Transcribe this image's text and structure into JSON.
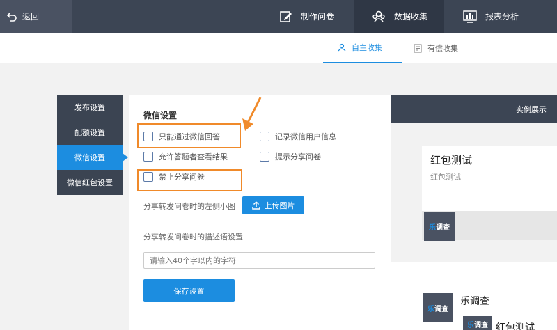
{
  "topbar": {
    "back_label": "返回",
    "tabs": [
      {
        "label": "制作问卷",
        "icon": "edit-icon"
      },
      {
        "label": "数据收集",
        "icon": "users-icon",
        "active": true
      },
      {
        "label": "报表分析",
        "icon": "chart-icon"
      }
    ]
  },
  "subbar": {
    "tabs": [
      {
        "label": "自主收集",
        "icon": "user-icon",
        "active": true
      },
      {
        "label": "有偿收集",
        "icon": "document-icon"
      }
    ]
  },
  "sidebar": {
    "items": [
      {
        "label": "发布设置"
      },
      {
        "label": "配额设置"
      },
      {
        "label": "微信设置",
        "active": true
      },
      {
        "label": "微信红包设置"
      }
    ]
  },
  "wechat_settings": {
    "title": "微信设置",
    "options": [
      {
        "label": "只能通过微信回答",
        "checked": false
      },
      {
        "label": "记录微信用户信息",
        "checked": false
      },
      {
        "label": "允许答题者查看结果",
        "checked": false
      },
      {
        "label": "提示分享问卷",
        "checked": false
      },
      {
        "label": "禁止分享问卷",
        "checked": false
      }
    ],
    "thumbnail_label": "分享转发问卷时的左侧小图",
    "upload_label": "上传图片",
    "description_label": "分享转发问卷时的描述语设置",
    "description_placeholder": "请输入40个字以内的字符",
    "save_label": "保存设置"
  },
  "preview": {
    "header": "实例展示",
    "card_title": "红包测试",
    "card_subtitle": "红包测试",
    "logo_text_1": "乐",
    "logo_text_2": "调查",
    "bottom_title": "乐调查",
    "bottom_title_2": "红包测试"
  },
  "colors": {
    "topbar": "#3c4554",
    "accent": "#1c8de0",
    "highlight": "#f08a2a"
  }
}
